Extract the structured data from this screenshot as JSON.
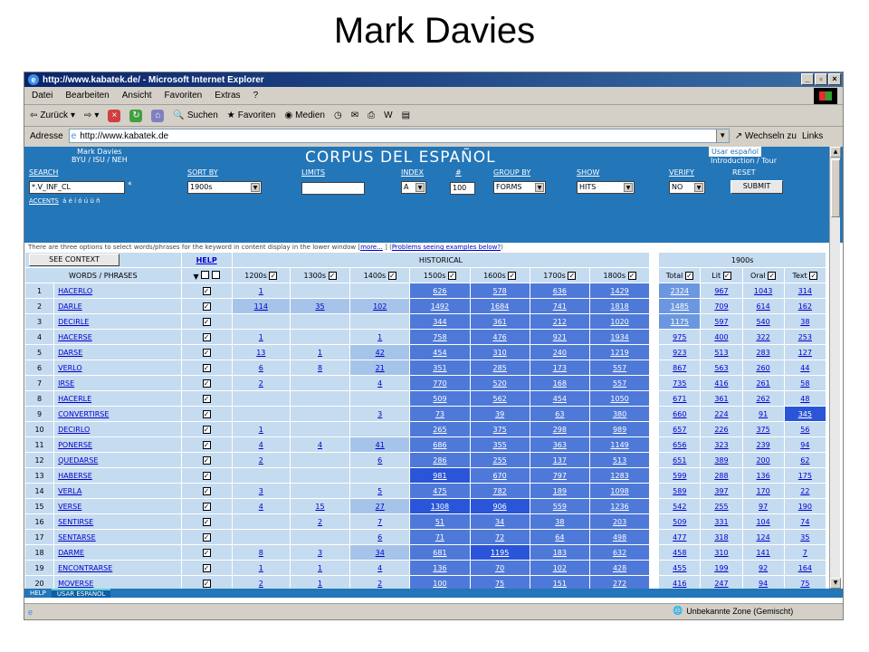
{
  "slide": {
    "title": "Mark Davies"
  },
  "window": {
    "title": "http://www.kabatek.de/ - Microsoft Internet Explorer",
    "menu": [
      "Datei",
      "Bearbeiten",
      "Ansicht",
      "Favoriten",
      "Extras",
      "?"
    ],
    "toolbar": {
      "back": "Zurück",
      "search": "Suchen",
      "favorites": "Favoriten",
      "media": "Medien"
    },
    "address": {
      "label": "Adresse",
      "value": "http://www.kabatek.de",
      "go": "Wechseln zu",
      "links": "Links"
    },
    "status": {
      "zone": "Unbekannte Zone (Gemischt)"
    }
  },
  "corpus": {
    "author_line1": "Mark Davies",
    "author_line2": "BYU / ISU / NEH",
    "title": "CORPUS DEL ESPAÑOL",
    "usar_link": "Usar español",
    "intro_link": "Introduction / Tour",
    "labels": {
      "search": "SEARCH",
      "sort_by": "SORT BY",
      "limits": "LIMITS",
      "index": "INDEX",
      "num": "#",
      "group_by": "GROUP BY",
      "show": "SHOW",
      "verify": "VERIFY",
      "reset": "RESET"
    },
    "controls": {
      "search_value": "*.V_INF_CL",
      "search_star": "*",
      "sort_value": "1900s",
      "limits_value": "",
      "index_value": "A",
      "num_value": "100",
      "group_value": "FORMS",
      "show_value": "HITS",
      "verify_value": "NO",
      "submit_label": "SUBMIT"
    },
    "accents_label": "ACCENTS",
    "accents_chars": "á é í ó ú ü ñ",
    "notice_text": "There are three options to select words/phrases for the keyword in content display in the lower window [",
    "notice_more": "more...",
    "notice_sep": " ] (",
    "notice_problems": "Problems seeing examples below?",
    "notice_end": ")",
    "see_context": "SEE CONTEXT",
    "help": "HELP",
    "historical": "HISTORICAL",
    "nineteen": "1900s",
    "col_words": "WORDS / PHRASES",
    "col_checks": "▼ ☐ ☐",
    "period_cols": [
      "1200s",
      "1300s",
      "1400s",
      "1500s",
      "1600s",
      "1700s",
      "1800s"
    ],
    "n1900_cols": [
      "Total",
      "Lit",
      "Oral",
      "Text"
    ],
    "rows": [
      {
        "n": "1",
        "w": "HACERLO",
        "h": [
          "1",
          "",
          "",
          "626",
          "578",
          "636",
          "1429"
        ],
        "m": [
          "2324",
          "967",
          "1043",
          "314"
        ]
      },
      {
        "n": "2",
        "w": "DARLE",
        "h": [
          "114",
          "35",
          "102",
          "1492",
          "1684",
          "741",
          "1818"
        ],
        "m": [
          "1485",
          "709",
          "614",
          "162"
        ]
      },
      {
        "n": "3",
        "w": "DECIRLE",
        "h": [
          "",
          "",
          "",
          "344",
          "361",
          "212",
          "1020"
        ],
        "m": [
          "1175",
          "597",
          "540",
          "38"
        ]
      },
      {
        "n": "4",
        "w": "HACERSE",
        "h": [
          "1",
          "",
          "1",
          "758",
          "476",
          "921",
          "1934"
        ],
        "m": [
          "975",
          "400",
          "322",
          "253"
        ]
      },
      {
        "n": "5",
        "w": "DARSE",
        "h": [
          "13",
          "1",
          "42",
          "454",
          "310",
          "240",
          "1219"
        ],
        "m": [
          "923",
          "513",
          "283",
          "127"
        ]
      },
      {
        "n": "6",
        "w": "VERLO",
        "h": [
          "6",
          "8",
          "21",
          "351",
          "285",
          "173",
          "557"
        ],
        "m": [
          "867",
          "563",
          "260",
          "44"
        ]
      },
      {
        "n": "7",
        "w": "IRSE",
        "h": [
          "2",
          "",
          "4",
          "770",
          "520",
          "168",
          "557"
        ],
        "m": [
          "735",
          "416",
          "261",
          "58"
        ]
      },
      {
        "n": "8",
        "w": "HACERLE",
        "h": [
          "",
          "",
          "",
          "509",
          "562",
          "454",
          "1050"
        ],
        "m": [
          "671",
          "361",
          "262",
          "48"
        ]
      },
      {
        "n": "9",
        "w": "CONVERTIRSE",
        "h": [
          "",
          "",
          "3",
          "73",
          "39",
          "63",
          "380"
        ],
        "m": [
          "660",
          "224",
          "91",
          "345"
        ]
      },
      {
        "n": "10",
        "w": "DECIRLO",
        "h": [
          "1",
          "",
          "",
          "265",
          "375",
          "298",
          "989"
        ],
        "m": [
          "657",
          "226",
          "375",
          "56"
        ]
      },
      {
        "n": "11",
        "w": "PONERSE",
        "h": [
          "4",
          "4",
          "41",
          "686",
          "355",
          "363",
          "1149"
        ],
        "m": [
          "656",
          "323",
          "239",
          "94"
        ]
      },
      {
        "n": "12",
        "w": "QUEDARSE",
        "h": [
          "2",
          "",
          "6",
          "286",
          "255",
          "137",
          "513"
        ],
        "m": [
          "651",
          "389",
          "200",
          "62"
        ]
      },
      {
        "n": "13",
        "w": "HABERSE",
        "h": [
          "",
          "",
          "",
          "981",
          "670",
          "797",
          "1283"
        ],
        "m": [
          "599",
          "288",
          "136",
          "175"
        ]
      },
      {
        "n": "14",
        "w": "VERLA",
        "h": [
          "3",
          "",
          "5",
          "475",
          "782",
          "189",
          "1098"
        ],
        "m": [
          "589",
          "397",
          "170",
          "22"
        ]
      },
      {
        "n": "15",
        "w": "VERSE",
        "h": [
          "4",
          "15",
          "27",
          "1308",
          "906",
          "559",
          "1236"
        ],
        "m": [
          "542",
          "255",
          "97",
          "190"
        ]
      },
      {
        "n": "16",
        "w": "SENTIRSE",
        "h": [
          "",
          "2",
          "7",
          "51",
          "34",
          "38",
          "203"
        ],
        "m": [
          "509",
          "331",
          "104",
          "74"
        ]
      },
      {
        "n": "17",
        "w": "SENTARSE",
        "h": [
          "",
          "",
          "6",
          "71",
          "72",
          "64",
          "498"
        ],
        "m": [
          "477",
          "318",
          "124",
          "35"
        ]
      },
      {
        "n": "18",
        "w": "DARME",
        "h": [
          "8",
          "3",
          "34",
          "681",
          "1195",
          "183",
          "632"
        ],
        "m": [
          "458",
          "310",
          "141",
          "7"
        ]
      },
      {
        "n": "19",
        "w": "ENCONTRARSE",
        "h": [
          "1",
          "1",
          "4",
          "136",
          "70",
          "102",
          "428"
        ],
        "m": [
          "455",
          "199",
          "92",
          "164"
        ]
      },
      {
        "n": "20",
        "w": "MOVERSE",
        "h": [
          "2",
          "1",
          "2",
          "100",
          "75",
          "151",
          "272"
        ],
        "m": [
          "416",
          "247",
          "94",
          "75"
        ]
      }
    ],
    "bottom_tabs": [
      "HELP",
      "USAR ESPANOL"
    ]
  }
}
